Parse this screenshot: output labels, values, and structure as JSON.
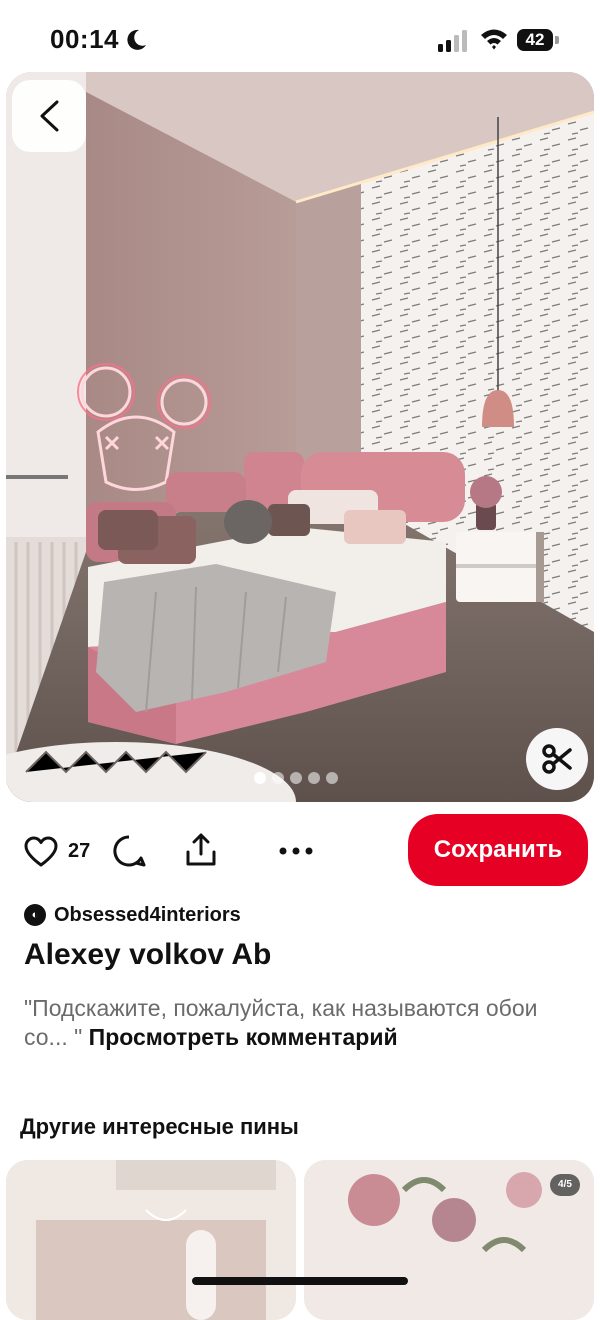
{
  "status_bar": {
    "time": "00:14",
    "battery": "42",
    "icons": [
      "moon-icon",
      "signal-icon",
      "wifi-icon",
      "battery-icon"
    ]
  },
  "pin": {
    "carousel_total": 5,
    "carousel_active": 1,
    "icons": [
      "back-chevron-icon",
      "scissors-icon"
    ]
  },
  "actions": {
    "like_count": "27",
    "save_label": "Сохранить",
    "icons": [
      "heart-icon",
      "comment-icon",
      "share-icon",
      "more-icon"
    ]
  },
  "author": {
    "name": "Obsessed4interiors"
  },
  "title": "Alexey volkov Ab",
  "comment": {
    "text": "\"Подскажите, пожалуйста, как называются обои со... \"",
    "link": "Просмотреть комментарий"
  },
  "more_pins": {
    "section_title": "Другие интересные пины",
    "right_badge": "4/5"
  },
  "colors": {
    "save": "#e60023",
    "accent_pink": "#d48b93"
  }
}
